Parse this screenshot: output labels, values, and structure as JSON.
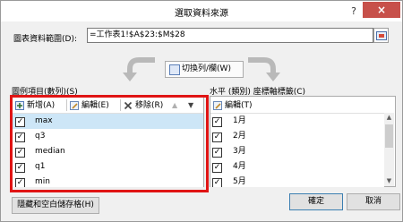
{
  "window": {
    "title": "選取資料來源",
    "help_label": "?",
    "close_label": "×"
  },
  "range": {
    "label": "圖表資料範圍(D):",
    "value": "=工作表1!$A$23:$M$28"
  },
  "switch": {
    "label": "切換列/欄(W)"
  },
  "legend": {
    "label": "圖例項目(數列)(S)",
    "toolbar": {
      "add": "新增(A)",
      "edit": "編輯(E)",
      "remove": "移除(R)",
      "up": "▲",
      "down": "▼"
    },
    "items": [
      {
        "label": "max",
        "checked": true,
        "selected": true
      },
      {
        "label": "q3",
        "checked": true
      },
      {
        "label": "median",
        "checked": true
      },
      {
        "label": "q1",
        "checked": true
      },
      {
        "label": "min",
        "checked": true
      }
    ]
  },
  "axis": {
    "label": "水平 (類別) 座標軸標籤(C)",
    "toolbar": {
      "edit": "編輯(T)"
    },
    "items": [
      {
        "label": "1月",
        "checked": true
      },
      {
        "label": "2月",
        "checked": true
      },
      {
        "label": "3月",
        "checked": true
      },
      {
        "label": "4月",
        "checked": true
      },
      {
        "label": "5月",
        "checked": true
      }
    ]
  },
  "footer": {
    "hidden_cells": "隱藏和空白儲存格(H)",
    "ok": "確定",
    "cancel": "取消"
  },
  "colors": {
    "highlight": "#e01414",
    "selection": "#cde6f7",
    "close": "#c7504a"
  }
}
